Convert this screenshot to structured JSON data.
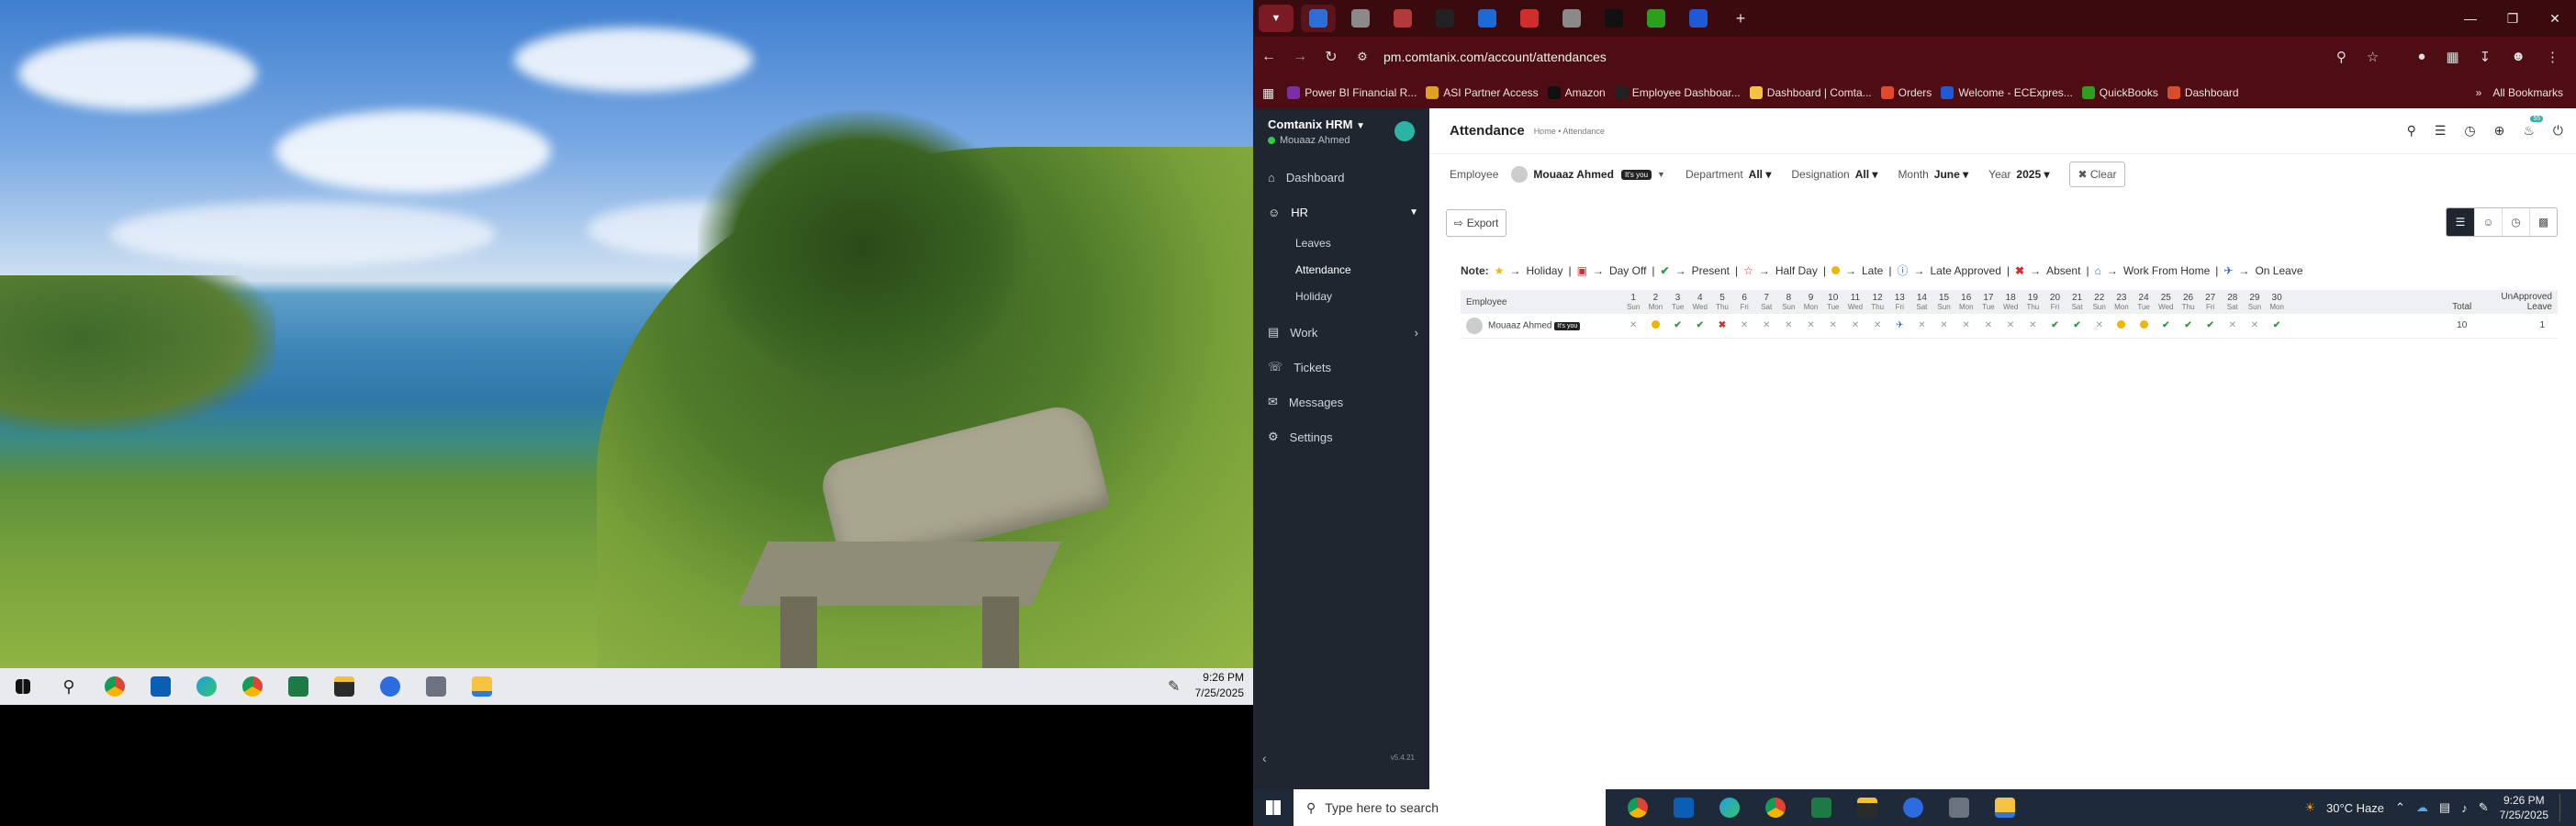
{
  "left_taskbar": {
    "time": "9:26 PM",
    "date": "7/25/2025",
    "apps": [
      "windows-start-icon",
      "search-icon",
      "chrome-icon",
      "outlook-icon",
      "edge-icon",
      "chrome-icon",
      "excel-icon",
      "sticky-notes-icon",
      "zoom-icon",
      "calculator-icon",
      "file-explorer-icon"
    ]
  },
  "browser": {
    "url": "pm.comtanix.com/account/attendances",
    "bookmarks": [
      {
        "label": "Power BI Financial R...",
        "color": "#7b2ea8"
      },
      {
        "label": "ASI Partner Access",
        "color": "#e0a020"
      },
      {
        "label": "Amazon",
        "color": "#111111"
      },
      {
        "label": "Employee Dashboar...",
        "color": "#222222"
      },
      {
        "label": "Dashboard | Comta...",
        "color": "#f5c242"
      },
      {
        "label": "Orders",
        "color": "#e24a2a"
      },
      {
        "label": "Welcome - ECExpres...",
        "color": "#1d5bd6"
      },
      {
        "label": "QuickBooks",
        "color": "#2ca01c"
      },
      {
        "label": "Dashboard",
        "color": "#d94e2a"
      }
    ],
    "all_bookmarks": "All Bookmarks",
    "tab_colors": [
      "#2d6fd4",
      "#8a8a8a",
      "#b23a3a",
      "#222222",
      "#1d6ad6",
      "#d12d2d",
      "#8a8a8a",
      "#111111",
      "#2ca01c",
      "#1d5bd6"
    ]
  },
  "app": {
    "brand": "Comtanix HRM",
    "user": "Mouaaz Ahmed",
    "nav": {
      "dashboard": "Dashboard",
      "hr": "HR",
      "leaves": "Leaves",
      "attendance": "Attendance",
      "holiday": "Holiday",
      "work": "Work",
      "tickets": "Tickets",
      "messages": "Messages",
      "settings": "Settings"
    },
    "version": "v5.4.21",
    "page_title": "Attendance",
    "breadcrumb": "Home • Attendance",
    "notification_count": "55",
    "filters": {
      "employee_label": "Employee",
      "employee_value": "Mouaaz Ahmed",
      "employee_badge": "It's you",
      "department_label": "Department",
      "department_value": "All",
      "designation_label": "Designation",
      "designation_value": "All",
      "month_label": "Month",
      "month_value": "June",
      "year_label": "Year",
      "year_value": "2025",
      "clear": "Clear"
    },
    "export": "Export",
    "legend": {
      "note": "Note:",
      "holiday": "Holiday",
      "day_off": "Day Off",
      "present": "Present",
      "half_day": "Half Day",
      "late": "Late",
      "late_approved": "Late Approved",
      "absent": "Absent",
      "wfh": "Work From Home",
      "on_leave": "On Leave"
    },
    "table": {
      "employee_header": "Employee",
      "total_header": "Total",
      "unapproved_header": "UnApproved",
      "leave_header": "Leave",
      "days": [
        "1",
        "2",
        "3",
        "4",
        "5",
        "6",
        "7",
        "8",
        "9",
        "10",
        "11",
        "12",
        "13",
        "14",
        "15",
        "16",
        "17",
        "18",
        "19",
        "20",
        "21",
        "22",
        "23",
        "24",
        "25",
        "26",
        "27",
        "28",
        "29",
        "30"
      ],
      "weekdays": [
        "Sun",
        "Mon",
        "Tue",
        "Wed",
        "Thu",
        "Fri",
        "Sat",
        "Sun",
        "Mon",
        "Tue",
        "Wed",
        "Thu",
        "Fri",
        "Sat",
        "Sun",
        "Mon",
        "Tue",
        "Wed",
        "Thu",
        "Fri",
        "Sat",
        "Sun",
        "Mon",
        "Tue",
        "Wed",
        "Thu",
        "Fri",
        "Sat",
        "Sun",
        "Mon"
      ],
      "row": {
        "name": "Mouaaz Ahmed",
        "badge": "It's you",
        "marks": [
          "x",
          "late",
          "ok",
          "ok",
          "abs",
          "x",
          "x",
          "x",
          "x",
          "x",
          "x",
          "x",
          "leave",
          "x",
          "x",
          "x",
          "x",
          "x",
          "x",
          "ok",
          "ok",
          "x",
          "late",
          "late",
          "ok",
          "ok",
          "ok",
          "x",
          "x",
          "ok"
        ],
        "total": "10",
        "unapproved_leave": "1"
      }
    }
  },
  "bottom_taskbar": {
    "search_placeholder": "Type here to search",
    "weather": "30°C  Haze",
    "time": "9:26 PM",
    "date": "7/25/2025"
  }
}
